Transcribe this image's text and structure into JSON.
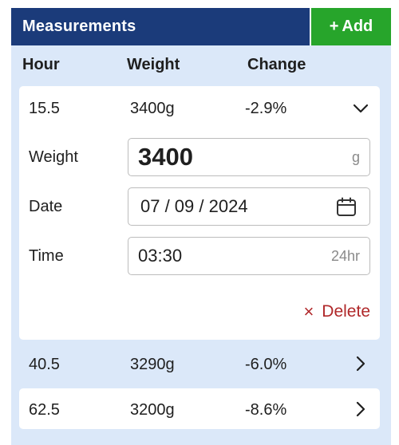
{
  "header": {
    "title": "Measurements",
    "add_plus": "+",
    "add_label": "Add"
  },
  "columns": [
    "Hour",
    "Weight",
    "Change"
  ],
  "expanded_row": {
    "hour": "15.5",
    "weight": "3400g",
    "change": "-2.9%",
    "fields": {
      "weight_label": "Weight",
      "weight_value": "3400",
      "weight_unit": "g",
      "date_label": "Date",
      "date_value": "07 / 09 / 2024",
      "time_label": "Time",
      "time_value": "03:30",
      "time_unit": "24hr"
    },
    "delete_label": "Delete",
    "delete_icon": "×"
  },
  "rows": [
    {
      "hour": "40.5",
      "weight": "3290g",
      "change": "-6.0%"
    },
    {
      "hour": "62.5",
      "weight": "3200g",
      "change": "-8.6%"
    }
  ],
  "colors": {
    "header_bg": "#1b3b7a",
    "add_bg": "#27a52b",
    "panel_bg": "#dbe8f9",
    "delete": "#b0282a"
  }
}
